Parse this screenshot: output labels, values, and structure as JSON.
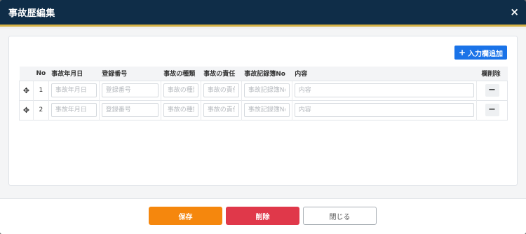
{
  "modal": {
    "title": "事故歴編集",
    "close_icon": "×"
  },
  "toolbar": {
    "add_label": "入力欄追加",
    "add_icon": "+"
  },
  "table": {
    "headers": {
      "no": "No",
      "accident_date": "事故年月日",
      "registration_number": "登録番号",
      "accident_type": "事故の種類",
      "accident_responsibility": "事故の責任",
      "accident_record_no": "事故記録簿No",
      "content": "内容",
      "row_delete": "欄削除"
    },
    "rows": [
      {
        "no": "1",
        "accident_date_placeholder": "事故年月日",
        "registration_number_placeholder": "登録番号",
        "accident_type_placeholder": "事故の種類",
        "accident_responsibility_placeholder": "事故の責任",
        "accident_record_no_placeholder": "事故記録簿No",
        "content_placeholder": "内容",
        "delete_label": "−"
      },
      {
        "no": "2",
        "accident_date_placeholder": "事故年月日",
        "registration_number_placeholder": "登録番号",
        "accident_type_placeholder": "事故の種類",
        "accident_responsibility_placeholder": "事故の責任",
        "accident_record_no_placeholder": "事故記録簿No",
        "content_placeholder": "内容",
        "delete_label": "−"
      }
    ]
  },
  "footer": {
    "save_label": "保存",
    "delete_label": "削除",
    "close_label": "閉じる"
  },
  "colors": {
    "header_bg": "#0f2d48",
    "header_accent": "#d6b245",
    "add_button": "#1a73e8",
    "save_button": "#f5870d",
    "delete_button": "#e0384a"
  },
  "icons": {
    "drag": "move-icon",
    "add": "plus-icon",
    "remove": "minus-icon",
    "close": "close-icon"
  }
}
